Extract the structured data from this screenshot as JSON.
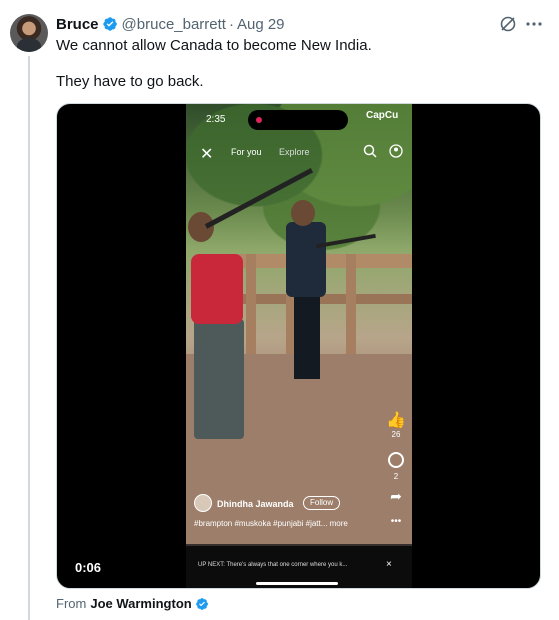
{
  "tweet": {
    "author_name": "Bruce",
    "handle": "@bruce_barrett",
    "separator": "·",
    "date": "Aug 29",
    "line1": "We cannot allow Canada to become New India.",
    "line2": "They have to go back."
  },
  "video": {
    "duration": "0:06",
    "phone_time": "2:35",
    "brand": "CapCu",
    "tabs": {
      "for_you": "For you",
      "explore": "Explore"
    },
    "likes": "26",
    "comments": "2",
    "creator": "Dhindha Jawanda",
    "follow_label": "Follow",
    "hashtags": "#brampton #muskoka #punjabi #jatt... more",
    "up_next": "UP NEXT: There's always that one corner where you k...",
    "up_next_close": "×"
  },
  "source": {
    "label": "From",
    "name": "Joe Warmington"
  },
  "colors": {
    "verified_blue": "#1d9bf0",
    "secondary_text": "#536471",
    "primary_text": "#0f1419"
  },
  "icons": {
    "verified": "verified-badge-icon",
    "grok": "grok-icon",
    "more": "more-horizontal-icon"
  }
}
